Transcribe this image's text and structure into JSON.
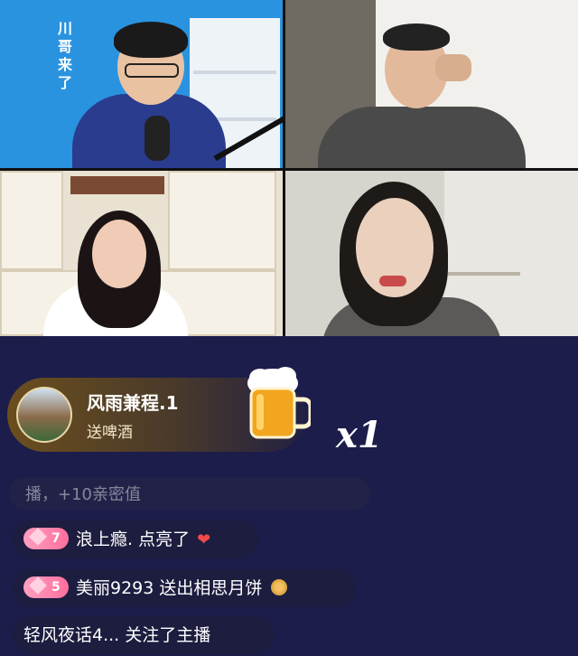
{
  "video_grid": {
    "host_label": "川哥来了"
  },
  "gift_banner": {
    "sender": "风雨兼程.1",
    "action": "送啤酒",
    "count": "x1"
  },
  "chat": [
    {
      "text": "播，+10亲密值",
      "level": null,
      "faded": true
    },
    {
      "text": "浪上瘾. 点亮了",
      "level": "7",
      "suffix_icon": "heart-icon"
    },
    {
      "text": "美丽9293  送出相思月饼",
      "level": "5",
      "suffix_icon": "mooncake-icon"
    },
    {
      "text": "轻风夜话4... 关注了主播",
      "level": null
    }
  ]
}
